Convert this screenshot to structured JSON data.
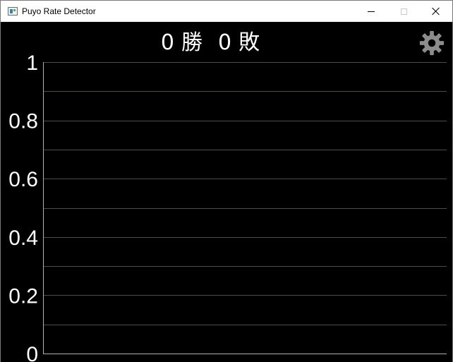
{
  "window": {
    "title": "Puyo Rate Detector",
    "icon": "app-window-icon",
    "controls": [
      "minimize-icon",
      "maximize-icon",
      "close-icon"
    ]
  },
  "score": {
    "wins": "0",
    "wins_label": "勝",
    "losses": "0",
    "losses_label": "敗"
  },
  "settings": {
    "icon": "gear-icon"
  },
  "colors": {
    "background": "#000000",
    "text": "#ffffff",
    "gridline": "#4a523f",
    "gear": "#8c8c8c"
  },
  "chart_data": {
    "type": "line",
    "title": "",
    "xlabel": "",
    "ylabel": "",
    "ylim": [
      0,
      1
    ],
    "yticks": [
      0,
      0.2,
      0.4,
      0.6,
      0.8,
      1
    ],
    "ytick_labels": [
      "0",
      "0.2",
      "0.4",
      "0.6",
      "0.8",
      "1"
    ],
    "minor_gridlines": [
      0.1,
      0.3,
      0.5,
      0.7,
      0.9
    ],
    "grid": true,
    "x": [],
    "series": []
  }
}
